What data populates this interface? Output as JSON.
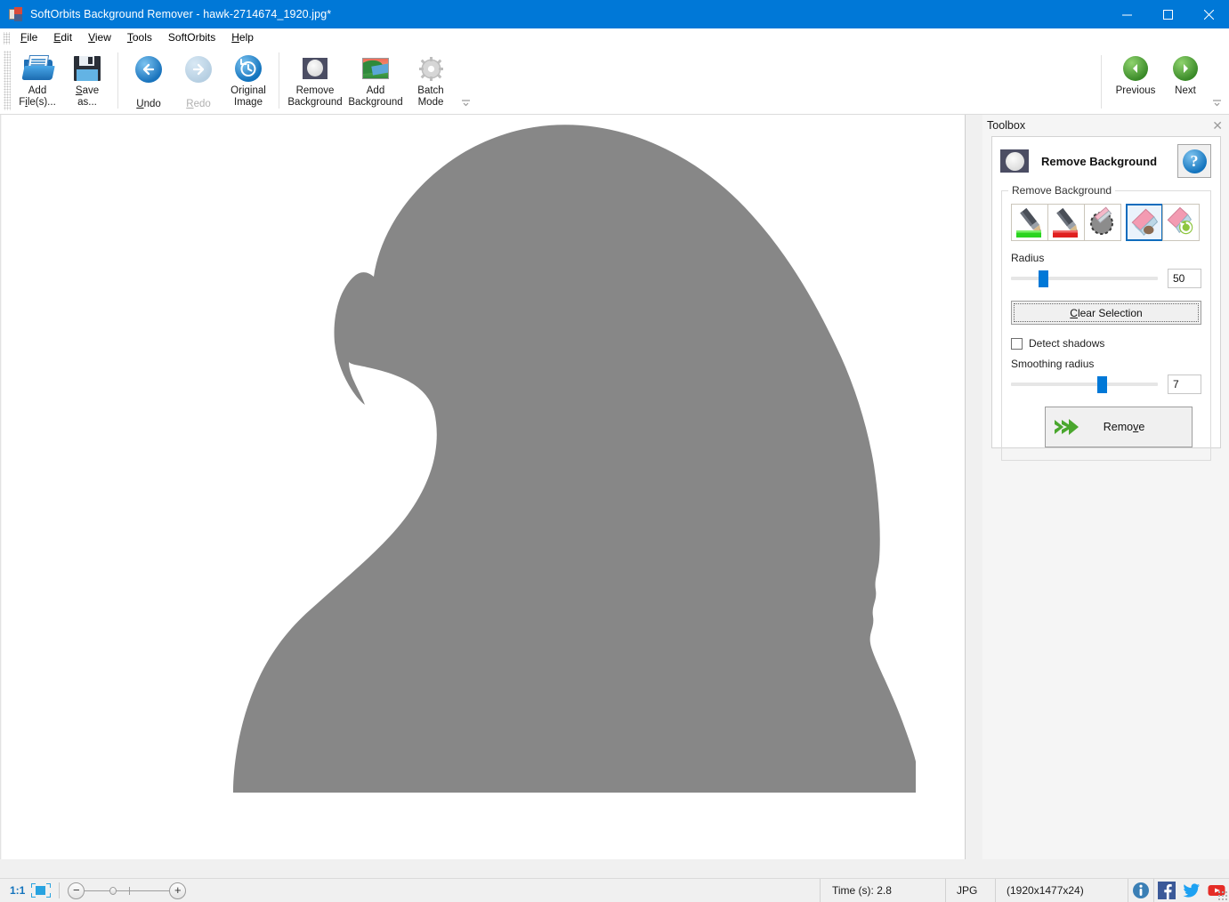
{
  "window": {
    "title": "SoftOrbits Background Remover - hawk-2714674_1920.jpg*",
    "icon": "app-icon",
    "minimize": "minimize-icon",
    "maximize": "maximize-icon",
    "close": "close-icon"
  },
  "menu": {
    "items": [
      {
        "label": "File",
        "accel": "F"
      },
      {
        "label": "Edit",
        "accel": "E"
      },
      {
        "label": "View",
        "accel": "V"
      },
      {
        "label": "Tools",
        "accel": "T"
      },
      {
        "label": "SoftOrbits",
        "accel": ""
      },
      {
        "label": "Help",
        "accel": "H"
      }
    ]
  },
  "toolbar": {
    "groups": [
      {
        "buttons": [
          {
            "label": "Add\nFile(s)...",
            "icon": "add-files-icon",
            "enabled": true
          },
          {
            "label": "Save\nas...",
            "icon": "save-as-icon",
            "enabled": true
          }
        ]
      },
      {
        "buttons": [
          {
            "label": "Undo",
            "icon": "undo-icon",
            "enabled": true
          },
          {
            "label": "Redo",
            "icon": "redo-icon",
            "enabled": false
          },
          {
            "label": "Original\nImage",
            "icon": "original-image-icon",
            "enabled": true
          }
        ]
      },
      {
        "buttons": [
          {
            "label": "Remove\nBackground",
            "icon": "remove-background-icon",
            "enabled": true
          },
          {
            "label": "Add\nBackground",
            "icon": "add-background-icon",
            "enabled": true
          },
          {
            "label": "Batch\nMode",
            "icon": "batch-mode-icon",
            "enabled": true
          }
        ]
      }
    ],
    "nav": {
      "previous": "Previous",
      "next": "Next",
      "previous_icon": "previous-arrow-icon",
      "next_icon": "next-arrow-icon"
    },
    "overflow": "toolbar-overflow-icon"
  },
  "canvas": {
    "background_color": "#ffffff",
    "subject_color": "#878787",
    "subject_name": "hawk-silhouette"
  },
  "toolbox": {
    "panel_title": "Toolbox",
    "close": "close-icon",
    "header": {
      "icon": "remove-background-icon",
      "title": "Remove Background",
      "help": "?"
    },
    "fieldset_legend": "Remove Background",
    "tools": [
      {
        "name": "mark-foreground-green-marker",
        "selected": false
      },
      {
        "name": "mark-background-red-marker",
        "selected": false
      },
      {
        "name": "eraser-selection-icon",
        "selected": false
      },
      {
        "name": "magic-eraser-icon",
        "selected": true
      },
      {
        "name": "restore-eraser-icon",
        "selected": false
      }
    ],
    "radius": {
      "label": "Radius",
      "value": "50",
      "percent": 22
    },
    "clear_selection": {
      "label": "Clear Selection",
      "accel": "C"
    },
    "detect_shadows": {
      "label": "Detect shadows",
      "checked": false
    },
    "smoothing_radius": {
      "label": "Smoothing radius",
      "value": "7",
      "percent": 62
    },
    "remove": {
      "label": "Remove",
      "accel": "v",
      "icon": "green-double-arrow-icon"
    }
  },
  "statusbar": {
    "zoom_ratio": "1:1",
    "fit_icon": "fit-to-window-icon",
    "zoom_out": "−",
    "zoom_in": "+",
    "time": "Time (s): 2.8",
    "format": "JPG",
    "dimensions": "(1920x1477x24)",
    "social": [
      {
        "name": "info-icon"
      },
      {
        "name": "facebook-icon"
      },
      {
        "name": "twitter-icon"
      },
      {
        "name": "youtube-icon"
      }
    ]
  },
  "colors": {
    "accent": "#0078d7",
    "title_bar": "#0078d7",
    "silhouette": "#878787",
    "green": "#3a8a28",
    "selected_tool_border": "#0f6cbd"
  }
}
